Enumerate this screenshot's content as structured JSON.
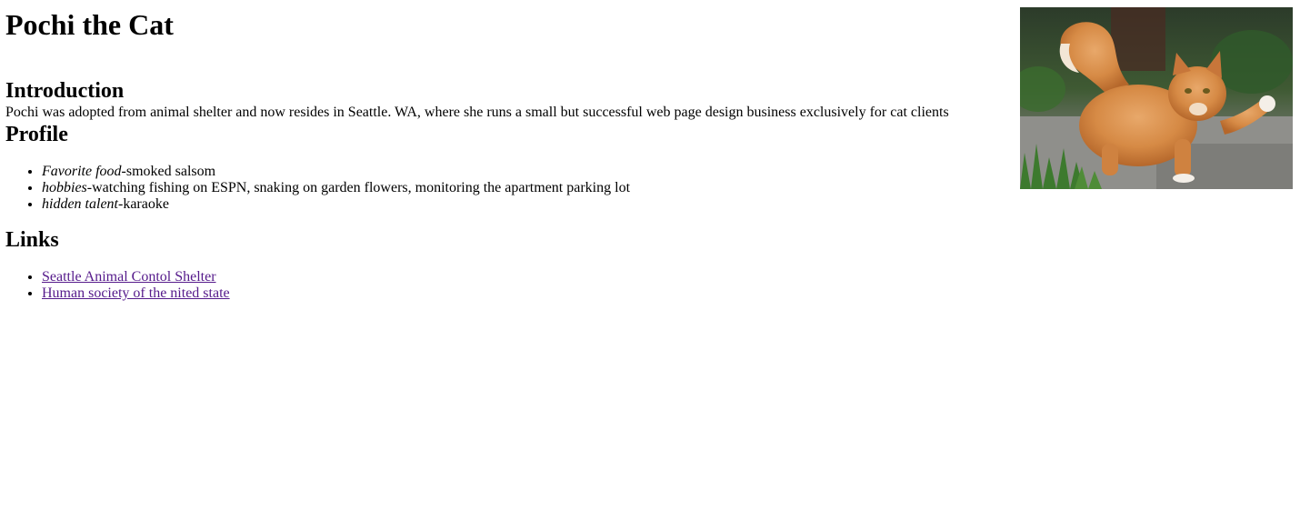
{
  "page": {
    "title": "Pochi the Cat"
  },
  "introduction": {
    "heading": "Introduction",
    "text": "Pochi was adopted from animal shelter and now resides in Seattle. WA, where she runs a small but successful web page design business exclusively for cat clients"
  },
  "profile": {
    "heading": "Profile",
    "items": [
      {
        "term": "Favorite food",
        "value": "-smoked salsom"
      },
      {
        "term": "hobbies",
        "value": "-watching fishing on ESPN, snaking on garden flowers, monitoring the apartment parking lot"
      },
      {
        "term": "hidden talent",
        "value": "-karaoke"
      }
    ]
  },
  "links": {
    "heading": "Links",
    "items": [
      {
        "label": "Seattle Animal Contol Shelter"
      },
      {
        "label": "Human society of the nited state"
      }
    ]
  },
  "image": {
    "subject": "orange-tabby-cat-photo"
  },
  "colors": {
    "visited_link": "#551a8b",
    "text": "#000000",
    "background": "#ffffff"
  }
}
